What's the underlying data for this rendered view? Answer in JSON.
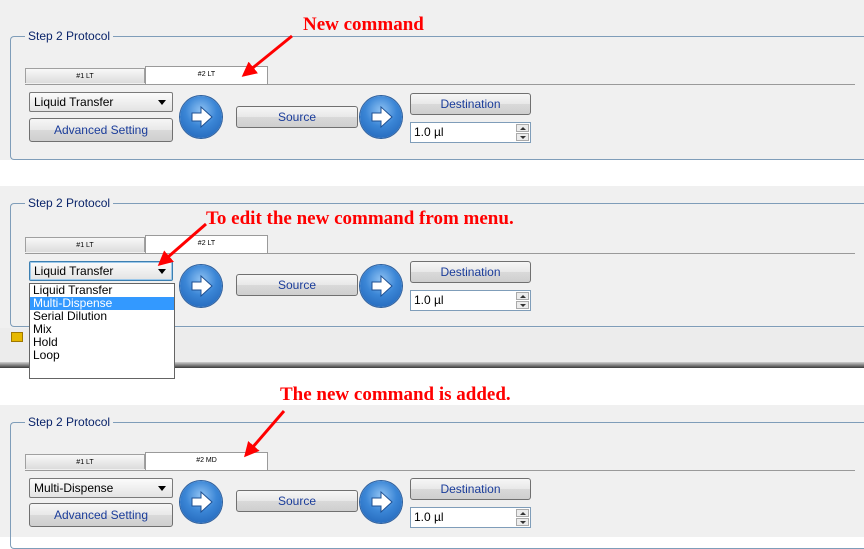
{
  "callouts": {
    "c1": "New command",
    "c2": "To edit the new command from menu.",
    "c3": "The new command is added."
  },
  "panels": [
    {
      "legend": "Step 2 Protocol",
      "tab1": "#1 LT",
      "tab2": "#2 LT",
      "combo": "Liquid Transfer",
      "advanced": "Advanced Setting",
      "source": "Source",
      "destination": "Destination",
      "volume": "1.0 µl"
    },
    {
      "legend": "Step 2 Protocol",
      "tab1": "#1 LT",
      "tab2": "#2 LT",
      "combo": "Liquid Transfer",
      "source": "Source",
      "destination": "Destination",
      "volume": "1.0 µl",
      "dropdown": [
        "Liquid Transfer",
        "Multi-Dispense",
        "Serial Dilution",
        "Mix",
        "Hold",
        "Loop"
      ],
      "dropdown_selected": "Multi-Dispense"
    },
    {
      "legend": "Step 2 Protocol",
      "tab1": "#1 LT",
      "tab2": "#2 MD",
      "combo": "Multi-Dispense",
      "advanced": "Advanced Setting",
      "source": "Source",
      "destination": "Destination",
      "volume": "1.0 µl"
    }
  ],
  "colors": {
    "callout": "#ff0000",
    "selection": "#3399ff",
    "orb": "#2f78cf"
  },
  "icons": [
    "arrow-orb-icon",
    "chevron-down-icon",
    "spin-up-icon",
    "spin-down-icon",
    "red-pointer-arrow-icon"
  ]
}
